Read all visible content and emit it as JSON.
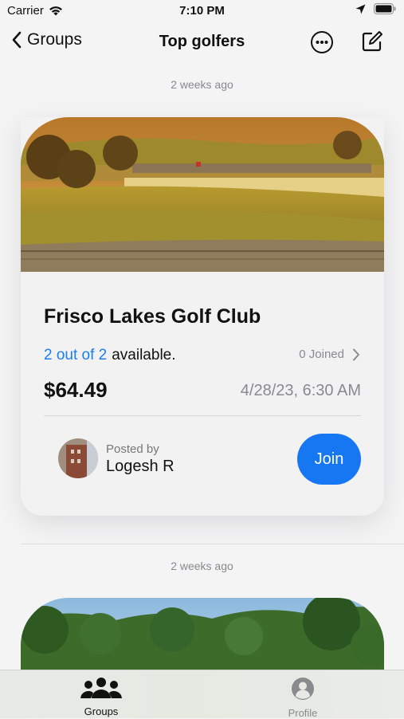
{
  "status_bar": {
    "carrier": "Carrier",
    "time": "7:10 PM"
  },
  "nav": {
    "back_label": "Groups",
    "title": "Top golfers"
  },
  "feed": [
    {
      "timestamp": "2 weeks ago",
      "course_name": "Frisco Lakes Golf Club",
      "availability_count": "2 out of 2",
      "availability_suffix": "available.",
      "joined": "0 Joined",
      "price": "$64.49",
      "datetime": "4/28/23, 6:30 AM",
      "posted_by_label": "Posted by",
      "posted_by_name": "Logesh R",
      "join_label": "Join"
    },
    {
      "timestamp": "2 weeks ago"
    }
  ],
  "tab_bar": {
    "items": [
      {
        "label": "Groups",
        "icon": "groups-icon",
        "active": true
      },
      {
        "label": "Profile",
        "icon": "profile-icon",
        "active": false
      }
    ]
  },
  "colors": {
    "accent": "#1677f2",
    "link": "#1a7ef2",
    "muted": "#8a8a8e"
  }
}
